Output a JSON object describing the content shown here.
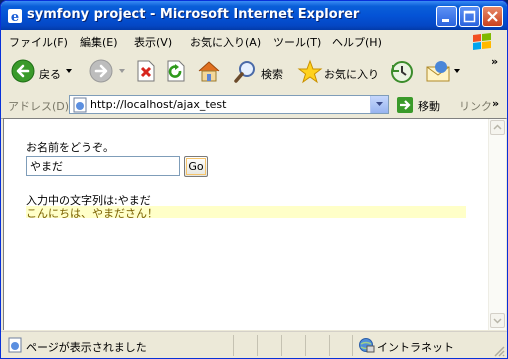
{
  "window": {
    "title": "symfony project - Microsoft Internet Explorer"
  },
  "menu": [
    {
      "label": "ファイル(F)"
    },
    {
      "label": "編集(E)"
    },
    {
      "label": "表示(V)"
    },
    {
      "label": "お気に入り(A)"
    },
    {
      "label": "ツール(T)"
    },
    {
      "label": "ヘルプ(H)"
    }
  ],
  "toolbar": {
    "back_label": "戻る",
    "search_label": "検索",
    "favorites_label": "お気に入り",
    "overflow": "»"
  },
  "address": {
    "label": "アドレス(D)",
    "url": "http://localhost/ajax_test",
    "go_label": "移動",
    "links_label": "リンク",
    "overflow": "»"
  },
  "page": {
    "prompt": "お名前をどうぞ。",
    "name_value": "やまだ",
    "submit_label": "Go",
    "typing_text": "入力中の文字列は:やまだ",
    "greeting_text": "こんにちは、やまださん！"
  },
  "status": {
    "text": "ページが表示されました",
    "zone": "イントラネット"
  },
  "colors": {
    "titlebar": "#0453d6",
    "greeting_highlight": "#ffffc8",
    "greeting_text": "#7a6000"
  }
}
